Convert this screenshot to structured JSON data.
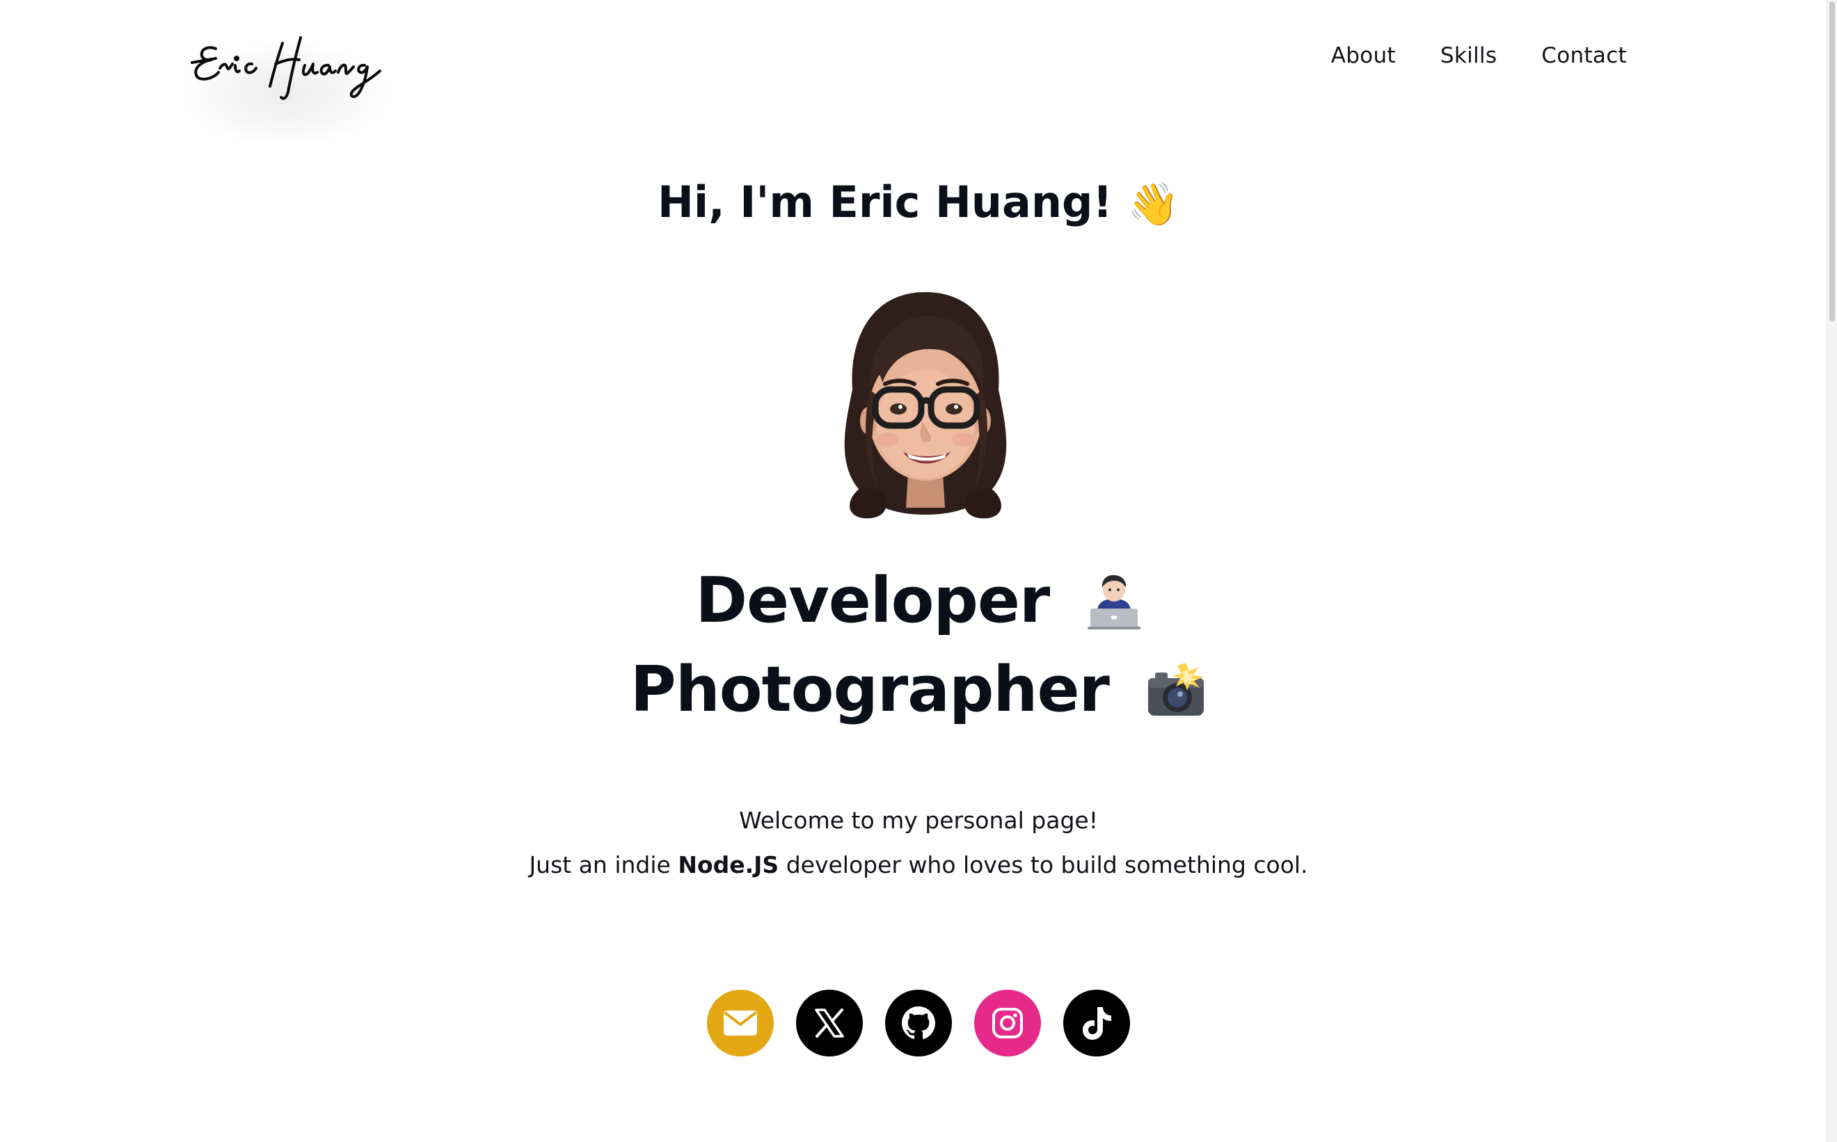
{
  "header": {
    "logo_text": "Eric Huang",
    "nav": [
      {
        "label": "About"
      },
      {
        "label": "Skills"
      },
      {
        "label": "Contact"
      }
    ]
  },
  "hero": {
    "greeting": "Hi, I'm Eric Huang!",
    "greeting_emoji": "👋",
    "avatar_icon": "memoji-avatar-icon",
    "roles": [
      {
        "label": "Developer",
        "icon": "technologist-laptop-icon"
      },
      {
        "label": "Photographer",
        "icon": "camera-flash-icon"
      }
    ]
  },
  "intro": {
    "line1": "Welcome to my personal page!",
    "line2_prefix": "Just an indie ",
    "line2_bold": "Node.JS",
    "line2_suffix": " developer who loves to build something cool."
  },
  "social": [
    {
      "name": "email",
      "icon": "envelope-icon",
      "color": "#E3A713"
    },
    {
      "name": "x",
      "icon": "x-logo-icon",
      "color": "#000000"
    },
    {
      "name": "github",
      "icon": "github-icon",
      "color": "#000000"
    },
    {
      "name": "instagram",
      "icon": "instagram-icon",
      "color": "#E6298B"
    },
    {
      "name": "tiktok",
      "icon": "tiktok-icon",
      "color": "#000000"
    }
  ]
}
